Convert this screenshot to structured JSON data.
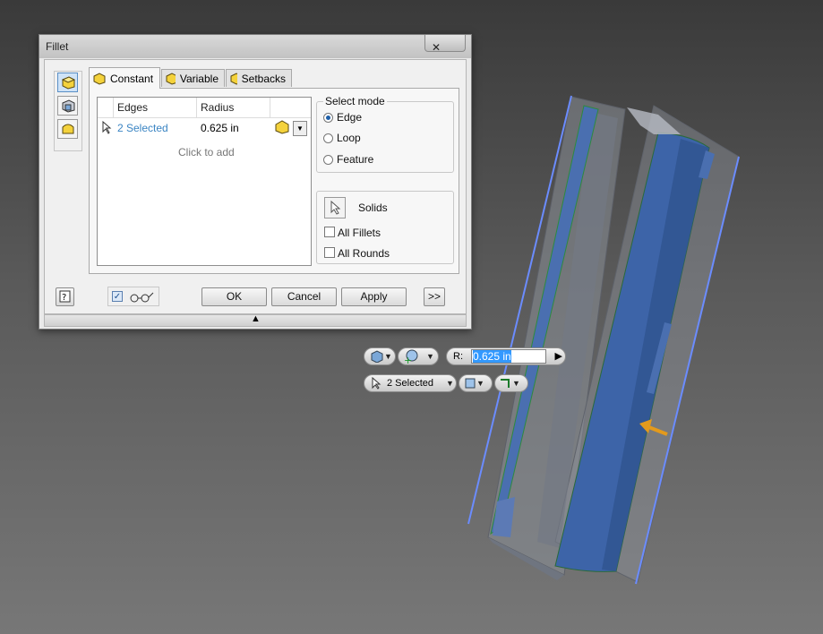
{
  "dialog": {
    "title": "Fillet",
    "close_icon": "✕",
    "tabs": [
      {
        "label": "Constant",
        "icon": "fillet-constant-icon",
        "active": true
      },
      {
        "label": "Variable",
        "icon": "fillet-variable-icon",
        "active": false
      },
      {
        "label": "Setbacks",
        "icon": "fillet-setbacks-icon",
        "active": false
      }
    ],
    "grid": {
      "headers": [
        "Edges",
        "Radius"
      ],
      "rows": [
        {
          "edges": "2 Selected",
          "radius": "0.625 in"
        }
      ],
      "add_row_text": "Click to add"
    },
    "select_mode": {
      "title": "Select mode",
      "options": [
        "Edge",
        "Loop",
        "Feature"
      ],
      "selected": "Edge"
    },
    "solids": {
      "label": "Solids",
      "all_fillets_label": "All Fillets",
      "all_rounds_label": "All Rounds"
    },
    "buttons": {
      "ok": "OK",
      "cancel": "Cancel",
      "apply": "Apply",
      "more": ">>"
    },
    "preview_checked": true,
    "expand_arrow": "▲"
  },
  "mini_toolbar": {
    "radius_label": "R:",
    "radius_value": "0.625 in",
    "selection_label": "2 Selected"
  },
  "colors": {
    "accent": "#3a84c3",
    "part_blue": "#3d64a8",
    "highlight_edge": "#6b8cff",
    "arrow": "#e39a1c"
  }
}
